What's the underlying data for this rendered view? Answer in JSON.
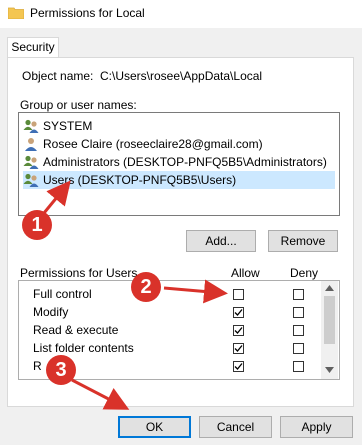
{
  "window": {
    "title": "Permissions for Local"
  },
  "tabs": [
    {
      "label": "Security"
    }
  ],
  "object": {
    "label": "Object name:",
    "value": "C:\\Users\\rosee\\AppData\\Local"
  },
  "group": {
    "label": "Group or user names:",
    "users": [
      {
        "name": "SYSTEM",
        "icon": "group-users-icon"
      },
      {
        "name": "Rosee Claire (roseeclaire28@gmail.com)",
        "icon": "single-user-icon"
      },
      {
        "name": "Administrators (DESKTOP-PNFQ5B5\\Administrators)",
        "icon": "group-users-icon"
      },
      {
        "name": "Users (DESKTOP-PNFQ5B5\\Users)",
        "icon": "group-users-icon",
        "selected": true
      }
    ],
    "add_label": "Add...",
    "remove_label": "Remove"
  },
  "permissions": {
    "title": "Permissions for Users",
    "allow_label": "Allow",
    "deny_label": "Deny",
    "rows": [
      {
        "name": "Full control",
        "allow": false,
        "deny": false
      },
      {
        "name": "Modify",
        "allow": true,
        "deny": false
      },
      {
        "name": "Read & execute",
        "allow": true,
        "deny": false
      },
      {
        "name": "List folder contents",
        "allow": true,
        "deny": false
      },
      {
        "name": "R",
        "allow": true,
        "deny": false
      }
    ]
  },
  "buttons": {
    "ok": "OK",
    "cancel": "Cancel",
    "apply": "Apply"
  },
  "callouts": [
    "1",
    "2",
    "3"
  ],
  "colors": {
    "callout": "#d9322a",
    "selection": "#cce8ff",
    "accent": "#0078d7"
  }
}
